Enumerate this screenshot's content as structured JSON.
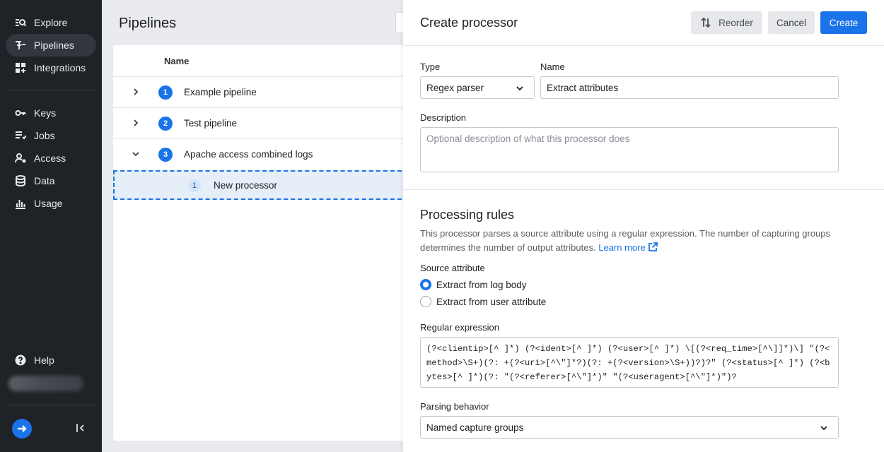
{
  "sidebar": {
    "items": [
      {
        "label": "Explore",
        "icon": "explore-icon"
      },
      {
        "label": "Pipelines",
        "icon": "pipelines-icon",
        "active": true
      },
      {
        "label": "Integrations",
        "icon": "integrations-icon"
      },
      {
        "label": "Keys",
        "icon": "key-icon"
      },
      {
        "label": "Jobs",
        "icon": "jobs-icon"
      },
      {
        "label": "Access",
        "icon": "access-icon"
      },
      {
        "label": "Data",
        "icon": "database-icon"
      },
      {
        "label": "Usage",
        "icon": "usage-icon"
      }
    ],
    "help_label": "Help"
  },
  "main": {
    "title": "Pipelines",
    "table": {
      "name_header": "Name",
      "rows": [
        {
          "number": "1",
          "name": "Example pipeline",
          "expanded": false
        },
        {
          "number": "2",
          "name": "Test pipeline",
          "expanded": false
        },
        {
          "number": "3",
          "name": "Apache access combined logs",
          "expanded": true
        }
      ],
      "processor": {
        "number": "1",
        "name": "New processor"
      }
    }
  },
  "panel": {
    "title": "Create processor",
    "buttons": {
      "reorder": "Reorder",
      "cancel": "Cancel",
      "create": "Create"
    },
    "type": {
      "label": "Type",
      "value": "Regex parser"
    },
    "name": {
      "label": "Name",
      "value": "Extract attributes"
    },
    "description": {
      "label": "Description",
      "placeholder": "Optional description of what this processor does",
      "value": ""
    },
    "processing": {
      "title": "Processing rules",
      "description": "This processor parses a source attribute using a regular expression. The number of capturing groups determines the number of output attributes.",
      "learn_more": "Learn more"
    },
    "source_attribute": {
      "label": "Source attribute",
      "options": [
        {
          "label": "Extract from log body",
          "selected": true
        },
        {
          "label": "Extract from user attribute",
          "selected": false
        }
      ]
    },
    "regex": {
      "label": "Regular expression",
      "value": "(?<clientip>[^ ]*) (?<ident>[^ ]*) (?<user>[^ ]*) \\[(?<req_time>[^\\]]*)\\] \"(?<method>\\S+)(?: +(?<uri>[^\\\"]*?)(?: +(?<version>\\S+))?)?\" (?<status>[^ ]*) (?<bytes>[^ ]*)(?: \"(?<referer>[^\\\"]*)\" \"(?<useragent>[^\\\"]*)\")?"
    },
    "parsing_behavior": {
      "label": "Parsing behavior",
      "value": "Named capture groups"
    }
  },
  "colors": {
    "accent": "#1a73e8",
    "sidebar_bg": "#1f2226",
    "sidebar_active": "#33373d",
    "selected_row": "#e6eef8"
  }
}
